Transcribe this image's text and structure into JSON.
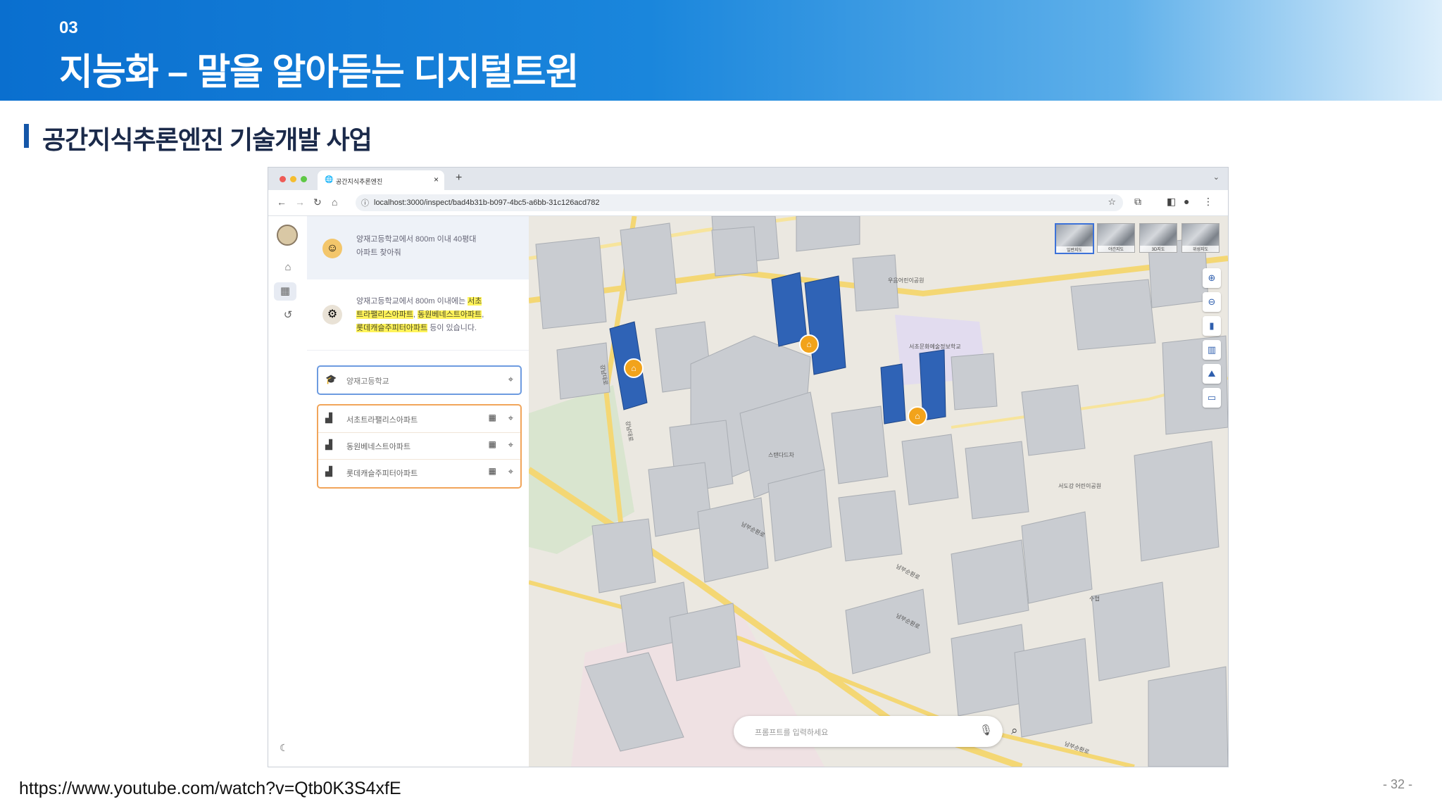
{
  "slide": {
    "section_number": "03",
    "title": "지능화 – 말을 알아듣는 디지털트윈",
    "subtitle": "공간지식추론엔진 기술개발 사업",
    "source_url": "https://www.youtube.com/watch?v=Qtb0K3S4xfE",
    "page_number": "- 32 -"
  },
  "browser": {
    "tab_title": "공간지식추론엔진",
    "tab_close": "×",
    "new_tab": "+",
    "url": "localhost:3000/inspect/bad4b31b-b097-4bc5-a6bb-31c126acd782"
  },
  "chat": {
    "user_message": [
      "양재고등학교에서 800m 이내 40평대",
      "아파트 찾아줘"
    ],
    "answer_prefix": "양재고등학교에서 800m 이내에는 ",
    "answer_h1": "서초",
    "answer_h2": "트라팰리스아파트",
    "answer_sep1": ", ",
    "answer_h3": "동원베네스트아파트",
    "answer_sep2": ",",
    "answer_h4": "롯데캐슬주피터아파트",
    "answer_suffix": " 등이 있습니다."
  },
  "search": {
    "value": "양재고등학교"
  },
  "results": [
    {
      "name": "서초트라팰리스아파트"
    },
    {
      "name": "동원베네스트아파트"
    },
    {
      "name": "롯데캐슬주피터아파트"
    }
  ],
  "map": {
    "basemap_thumbs": [
      "일반지도",
      "야간지도",
      "3D지도",
      "위성지도"
    ],
    "labels": {
      "park_top": "우음어린이공원",
      "school": "서초문화예술정보학교",
      "standard": "스탠다드차",
      "park_right": "서도강 어린이공원",
      "road_1": "남부순환로",
      "road_2": "남부순환로",
      "road_3": "남부순환로",
      "road_4": "남부순환로",
      "road_left": "강남대로",
      "road_right": "강남대로",
      "hotel": "수협"
    },
    "prompt_placeholder": "프롬프트를 입력하세요"
  },
  "colors": {
    "banner_start": "#0a6fcf",
    "highlight_building": "#2f63b6",
    "pin": "#f2a31b",
    "text_highlight": "#fff35a"
  }
}
